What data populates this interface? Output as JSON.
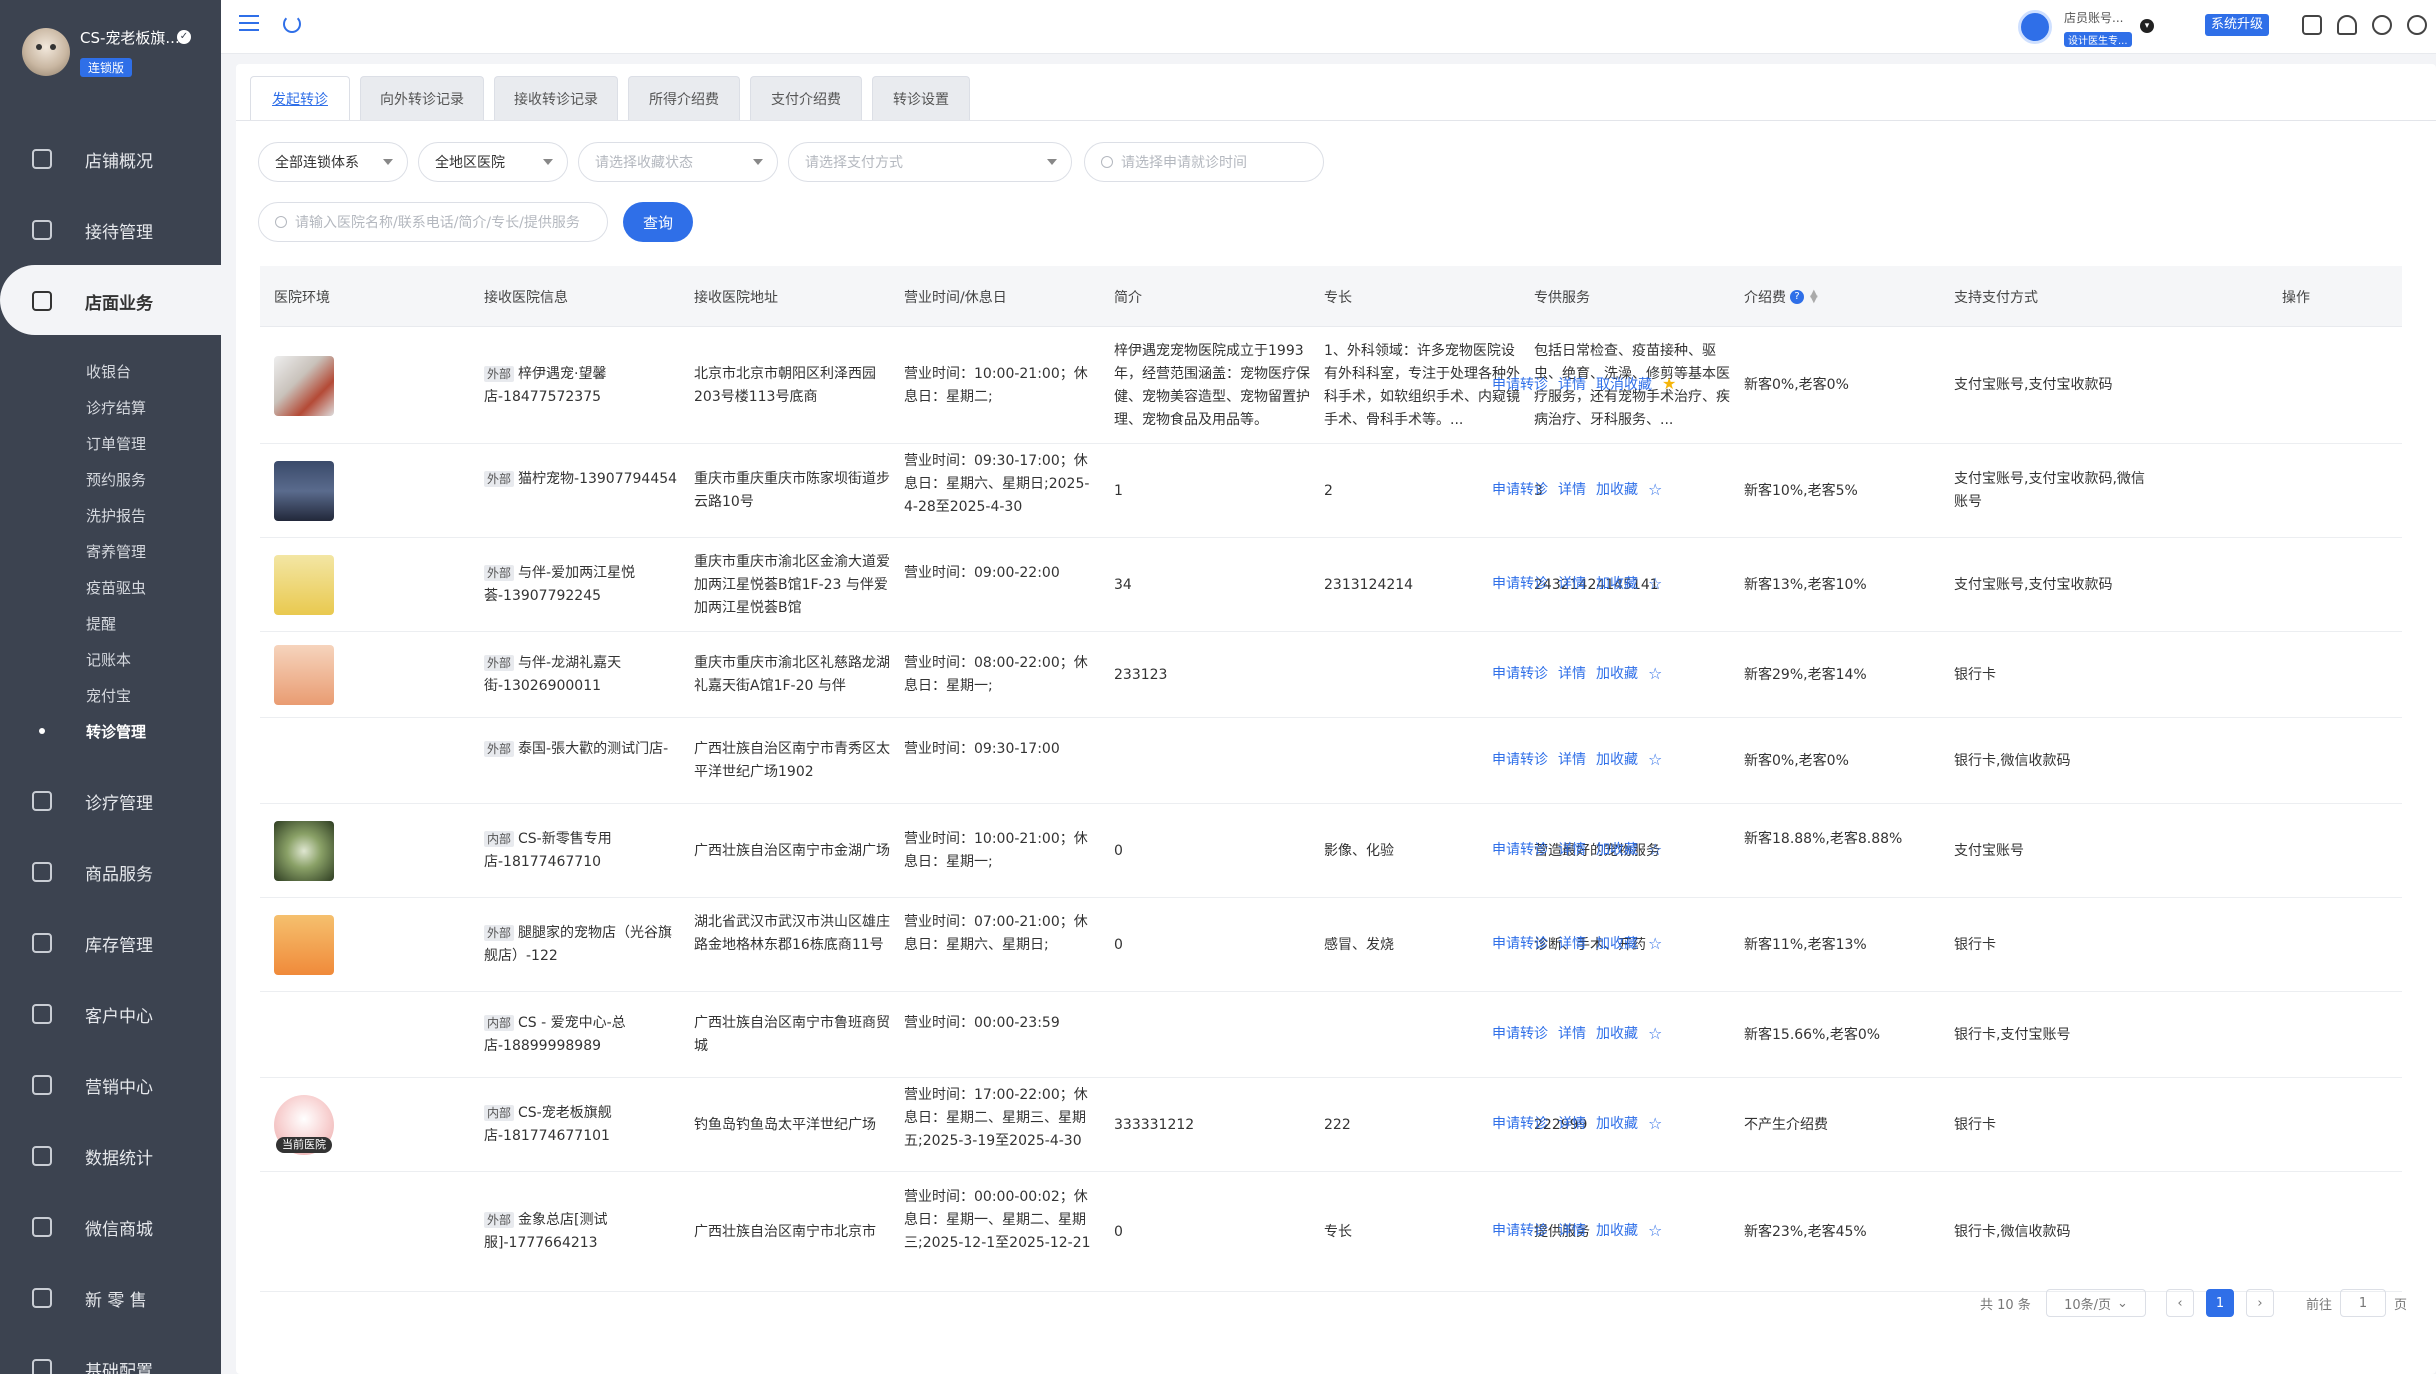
{
  "sidebar": {
    "store_name": "CS-宠老板旗...",
    "badge": "连锁版",
    "nav": [
      {
        "label": "店铺概况",
        "icon": "dashboard-icon"
      },
      {
        "label": "接待管理",
        "icon": "reception-icon"
      },
      {
        "label": "店面业务",
        "icon": "store-icon"
      },
      {
        "label": "诊疗管理",
        "icon": "medical-icon"
      },
      {
        "label": "商品服务",
        "icon": "goods-icon"
      },
      {
        "label": "库存管理",
        "icon": "inventory-icon"
      },
      {
        "label": "客户中心",
        "icon": "customer-icon"
      },
      {
        "label": "营销中心",
        "icon": "marketing-icon"
      },
      {
        "label": "数据统计",
        "icon": "statistics-icon"
      },
      {
        "label": "微信商城",
        "icon": "wechat-mall-icon"
      },
      {
        "label": "新 零 售",
        "icon": "new-retail-icon"
      },
      {
        "label": "基础配置",
        "icon": "settings-icon"
      }
    ],
    "sub_items": [
      "收银台",
      "诊疗结算",
      "订单管理",
      "预约服务",
      "洗护报告",
      "寄养管理",
      "疫苗驱虫",
      "提醒",
      "记账本",
      "宠付宝",
      "转诊管理"
    ]
  },
  "topbar": {
    "account": "店员账号...",
    "account_tag": "设计医生专...",
    "upgrade_label": "系统升级"
  },
  "tabs": [
    "发起转诊",
    "向外转诊记录",
    "接收转诊记录",
    "所得介绍费",
    "支付介绍费",
    "转诊设置"
  ],
  "filters": {
    "chain": "全部连锁体系",
    "region": "全地区医院",
    "collect_status": "请选择收藏状态",
    "payment": "请选择支付方式",
    "time": "请选择申请就诊时间",
    "search_placeholder": "请输入医院名称/联系电话/简介/专长/提供服务",
    "query_label": "查询"
  },
  "table": {
    "headers": [
      "医院环境",
      "接收医院信息",
      "接收医院地址",
      "营业时间/休息日",
      "简介",
      "专长",
      "专供服务",
      "介绍费",
      "支持支付方式",
      "操作"
    ],
    "rows": [
      {
        "tag": "外部",
        "name": "梓伊遇宠·望馨店-18477572375",
        "address": "北京市北京市朝阳区利泽西园203号楼113号底商",
        "hours": "营业时间：10:00-21:00；休息日：星期二;",
        "intro": "梓伊遇宠宠物医院成立于1993年，经营范围涵盖：宠物医疗保健、宠物美容造型、宠物留置护理、宠物食品及用品等。",
        "specialty": "1、外科领域：许多宠物医院设有外科科室，专注于处理各种外科手术，如软组织手术、内窥镜手术、骨科手术等。...",
        "service": "包括日常检查、疫苗接种、驱虫、绝育、洗澡、修剪等基本医疗服务，还有宠物手术治疗、疾病治疗、牙科服务、...",
        "fee": "新客0%,老客0%",
        "payment": "支付宝账号,支付宝收款码",
        "op1": "申请转诊",
        "op2": "详情",
        "op3": "取消收藏",
        "starred": true,
        "thumb": "cat-photo"
      },
      {
        "tag": "外部",
        "name": "猫柠宠物-13907794454",
        "address": "重庆市重庆重庆市陈家坝街道步云路10号",
        "hours": "营业时间：09:30-17:00；休息日：星期六、星期日;2025-4-28至2025-4-30",
        "intro": "1",
        "specialty": "2",
        "service": "3",
        "fee": "新客10%,老客5%",
        "payment": "支付宝账号,支付宝收款码,微信账号",
        "op1": "申请转诊",
        "op2": "详情",
        "op3": "加收藏",
        "starred": false,
        "thumb": "night-photo"
      },
      {
        "tag": "外部",
        "name": "与伴-爱加两江星悦荟-13907792245",
        "address": "重庆市重庆市渝北区金渝大道爱加两江星悦荟B馆1F-23 与伴爱加两江星悦荟B馆",
        "hours": "营业时间：09:00-22:00",
        "intro": "34",
        "specialty": "2313124214",
        "service": "24321424145141",
        "fee": "新客13%,老客10%",
        "payment": "支付宝账号,支付宝收款码",
        "op1": "申请转诊",
        "op2": "详情",
        "op3": "加收藏",
        "starred": false,
        "thumb": "wash-sign"
      },
      {
        "tag": "外部",
        "name": "与伴-龙湖礼嘉天街-13026900011",
        "address": "重庆市重庆市渝北区礼慈路龙湖礼嘉天街A馆1F-20 与伴",
        "hours": "营业时间：08:00-22:00；休息日：星期一;",
        "intro": "233123",
        "specialty": "",
        "service": "",
        "fee": "新客29%,老客14%",
        "payment": "银行卡",
        "op1": "申请转诊",
        "op2": "详情",
        "op3": "加收藏",
        "starred": false,
        "thumb": "spa-sign"
      },
      {
        "tag": "外部",
        "name": "泰国-張大歡的测试门店-",
        "address": "广西壮族自治区南宁市青秀区太平洋世纪广场1902",
        "hours": "营业时间：09:30-17:00",
        "intro": "",
        "specialty": "",
        "service": "",
        "fee": "新客0%,老客0%",
        "payment": "银行卡,微信收款码",
        "op1": "申请转诊",
        "op2": "详情",
        "op3": "加收藏",
        "starred": false,
        "thumb": ""
      },
      {
        "tag": "内部",
        "name": "CS-新零售专用店-18177467710",
        "address": "广西壮族自治区南宁市金湖广场",
        "hours": "营业时间：10:00-21:00；休息日：星期一;",
        "intro": "0",
        "specialty": "影像、化验",
        "service": "营造最好的宠物服务",
        "fee": "新客18.88%,老客8.88%",
        "payment": "支付宝账号",
        "op1": "申请转诊",
        "op2": "详情",
        "op3": "加收藏",
        "starred": false,
        "thumb": "dandelion-photo"
      },
      {
        "tag": "外部",
        "name": "腿腿家的宠物店（光谷旗舰店）-122",
        "address": "湖北省武汉市武汉市洪山区雄庄路金地格林东郡16栋底商11号",
        "hours": "营业时间：07:00-21:00；休息日：星期六、星期日;",
        "intro": "0",
        "specialty": "感冒、发烧",
        "service": "诊断、手术、开药",
        "fee": "新客11%,老客13%",
        "payment": "银行卡",
        "op1": "申请转诊",
        "op2": "详情",
        "op3": "加收藏",
        "starred": false,
        "thumb": "shop-sign"
      },
      {
        "tag": "内部",
        "name": "CS - 爱宠中心-总店-18899998989",
        "address": "广西壮族自治区南宁市鲁班商贸城",
        "hours": "营业时间：00:00-23:59",
        "intro": "",
        "specialty": "",
        "service": "",
        "fee": "新客15.66%,老客0%",
        "payment": "银行卡,支付宝账号",
        "op1": "申请转诊",
        "op2": "详情",
        "op3": "加收藏",
        "starred": false,
        "thumb": ""
      },
      {
        "tag": "内部",
        "name": "CS-宠老板旗舰店-181774677101",
        "address": "钓鱼岛钓鱼岛太平洋世纪广场",
        "hours": "营业时间：17:00-22:00；休息日：星期二、星期三、星期五;2025-3-19至2025-4-30",
        "intro": "333331212",
        "specialty": "222",
        "service": "222999",
        "fee": "不产生介绍费",
        "payment": "银行卡",
        "op1": "申请转诊",
        "op2": "详情",
        "op3": "加收藏",
        "starred": false,
        "thumb": "mascot-logo",
        "thumb_label": "当前医院"
      },
      {
        "tag": "外部",
        "name": "金象总店[测试服]-1777664213",
        "address": "广西壮族自治区南宁市北京市",
        "hours": "营业时间：00:00-00:02；休息日：星期一、星期二、星期三;2025-12-1至2025-12-21",
        "intro": "0",
        "specialty": "专长",
        "service": "提供服务",
        "fee": "新客23%,老客45%",
        "payment": "银行卡,微信收款码",
        "op1": "申请转诊",
        "op2": "详情",
        "op3": "加收藏",
        "starred": false,
        "thumb": ""
      }
    ]
  },
  "pagination": {
    "total": "共 10 条",
    "page_size": "10条/页",
    "current": "1",
    "goto_label": "前往",
    "goto_value": "1",
    "page_suffix": "页"
  }
}
